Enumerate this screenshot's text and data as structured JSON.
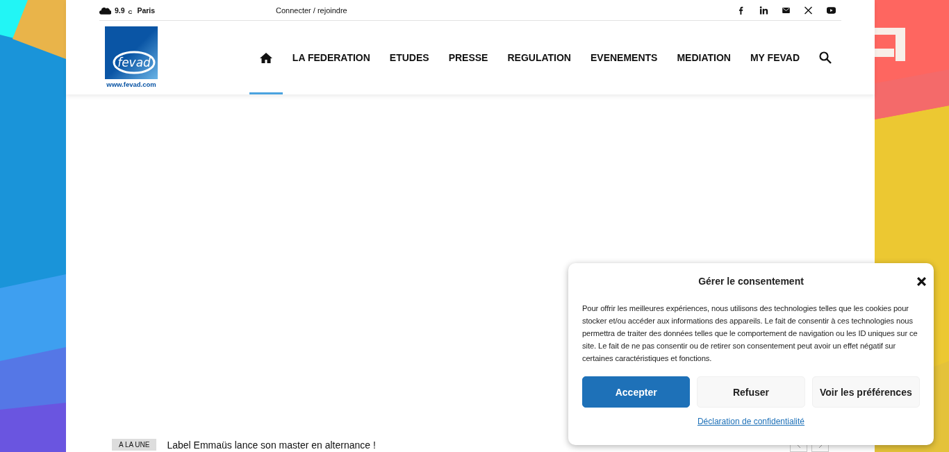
{
  "top_bar": {
    "weather": {
      "temperature": "9.9",
      "unit": "C",
      "city": "Paris"
    },
    "login_link": "Connecter / rejoindre",
    "social": [
      {
        "kind": "facebook"
      },
      {
        "kind": "linkedin"
      },
      {
        "kind": "mail"
      },
      {
        "kind": "x"
      },
      {
        "kind": "youtube"
      }
    ]
  },
  "logo": {
    "name": "fevad",
    "url": "www.fevad.com"
  },
  "nav": [
    {
      "kind": "home",
      "selected": true
    },
    {
      "kind": "text",
      "label": "LA FEDERATION",
      "selected": false
    },
    {
      "kind": "text",
      "label": "ETUDES",
      "selected": false
    },
    {
      "kind": "text",
      "label": "PRESSE",
      "selected": false
    },
    {
      "kind": "text",
      "label": "REGULATION",
      "selected": false
    },
    {
      "kind": "text",
      "label": "EVENEMENTS",
      "selected": false
    },
    {
      "kind": "text",
      "label": "MEDIATION",
      "selected": false
    },
    {
      "kind": "text",
      "label": "MY FEVAD",
      "selected": false
    },
    {
      "kind": "search",
      "selected": false
    }
  ],
  "ticker": {
    "tag": "A LA UNE",
    "headline": "Label Emmaüs lance son master en alternance !"
  },
  "consent": {
    "title": "Gérer le consentement",
    "body": "Pour offrir les meilleures expériences, nous utilisons des technologies telles que les cookies pour stocker et/ou accéder aux informations des appareils. Le fait de consentir à ces technologies nous permettra de traiter des données telles que le comportement de navigation ou les ID uniques sur ce site. Le fait de ne pas consentir ou de retirer son consentement peut avoir un effet négatif sur certaines caractéristiques et fonctions.",
    "buttons": [
      {
        "label": "Accepter",
        "kind": "primary"
      },
      {
        "label": "Refuser",
        "kind": "secondary"
      },
      {
        "label": "Voir les préférences",
        "kind": "secondary"
      }
    ],
    "link": "Déclaration de confidentialité"
  }
}
